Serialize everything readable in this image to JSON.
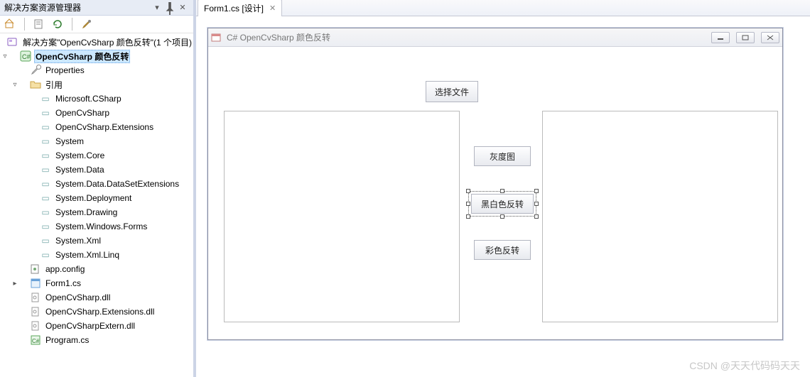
{
  "explorer": {
    "title": "解决方案资源管理器",
    "solution": {
      "label": "解决方案\"OpenCvSharp 颜色反转\"(1 个项目)"
    },
    "project": {
      "label": "OpenCvSharp 颜色反转"
    },
    "properties": "Properties",
    "references_label": "引用",
    "references": [
      "Microsoft.CSharp",
      "OpenCvSharp",
      "OpenCvSharp.Extensions",
      "System",
      "System.Core",
      "System.Data",
      "System.Data.DataSetExtensions",
      "System.Deployment",
      "System.Drawing",
      "System.Windows.Forms",
      "System.Xml",
      "System.Xml.Linq"
    ],
    "files": {
      "appconfig": "app.config",
      "form1": "Form1.cs",
      "dll1": "OpenCvSharp.dll",
      "dll2": "OpenCvSharp.Extensions.dll",
      "dll3": "OpenCvSharpExtern.dll",
      "program": "Program.cs"
    }
  },
  "doc": {
    "tab": "Form1.cs [设计]"
  },
  "form": {
    "title": "C# OpenCvSharp 颜色反转",
    "buttons": {
      "select": "选择文件",
      "gray": "灰度图",
      "bw": "黑白色反转",
      "color": "彩色反转"
    }
  },
  "watermark": "CSDN @天天代码码天天",
  "titlebar_icons": {
    "down": "▾",
    "pin": "⟂",
    "close": "✕"
  }
}
